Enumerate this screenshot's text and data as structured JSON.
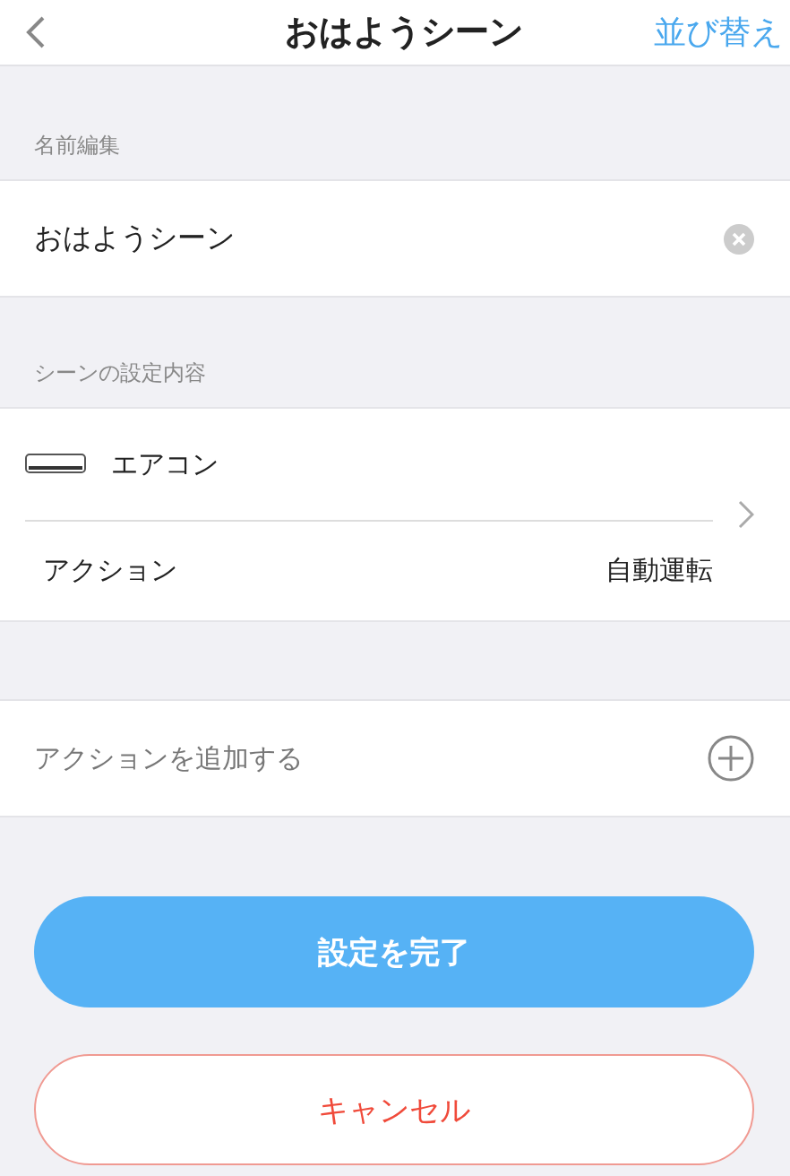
{
  "nav": {
    "title": "おはようシーン",
    "action": "並び替え"
  },
  "name_section": {
    "header": "名前編集",
    "value": "おはようシーン"
  },
  "scene_section": {
    "header": "シーンの設定内容",
    "device": "エアコン",
    "action_label": "アクション",
    "action_value": "自動運転"
  },
  "add_action": "アクションを追加する",
  "buttons": [
    {
      "kind": "primary",
      "label": "設定を完了"
    },
    {
      "kind": "cancel",
      "label": "キャンセル"
    }
  ]
}
